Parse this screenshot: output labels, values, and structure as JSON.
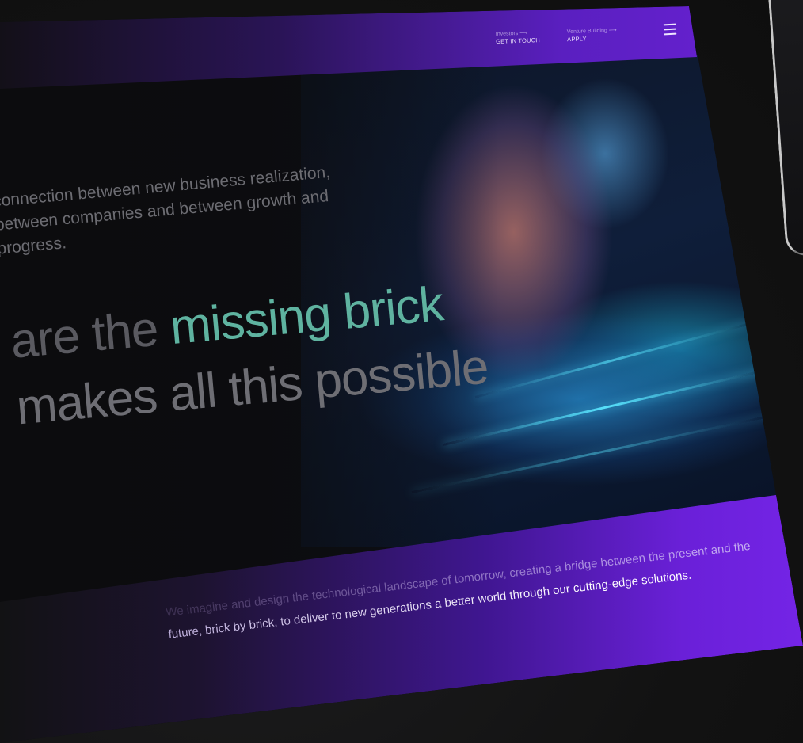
{
  "nav": {
    "left_small": "Investors ⟶",
    "left_label": "GET IN TOUCH",
    "right_small": "Venture Building ⟶",
    "right_label": "APPLY"
  },
  "hero": {
    "intro": "connection between new business realization, between companies and between growth and progress.",
    "headline_prefix": "are the ",
    "headline_accent": "missing brick",
    "headline_line2": "makes all this possible"
  },
  "mission": {
    "text": "We imagine and design the technological landscape of tomorrow, creating a bridge between the present and the future, brick by brick, to deliver to new generations a better world through our cutting-edge solutions."
  },
  "colors": {
    "purple": "#6b22d6",
    "accent_teal": "#5fb3a0",
    "background": "#141414"
  },
  "icons": [
    "menu-icon"
  ]
}
